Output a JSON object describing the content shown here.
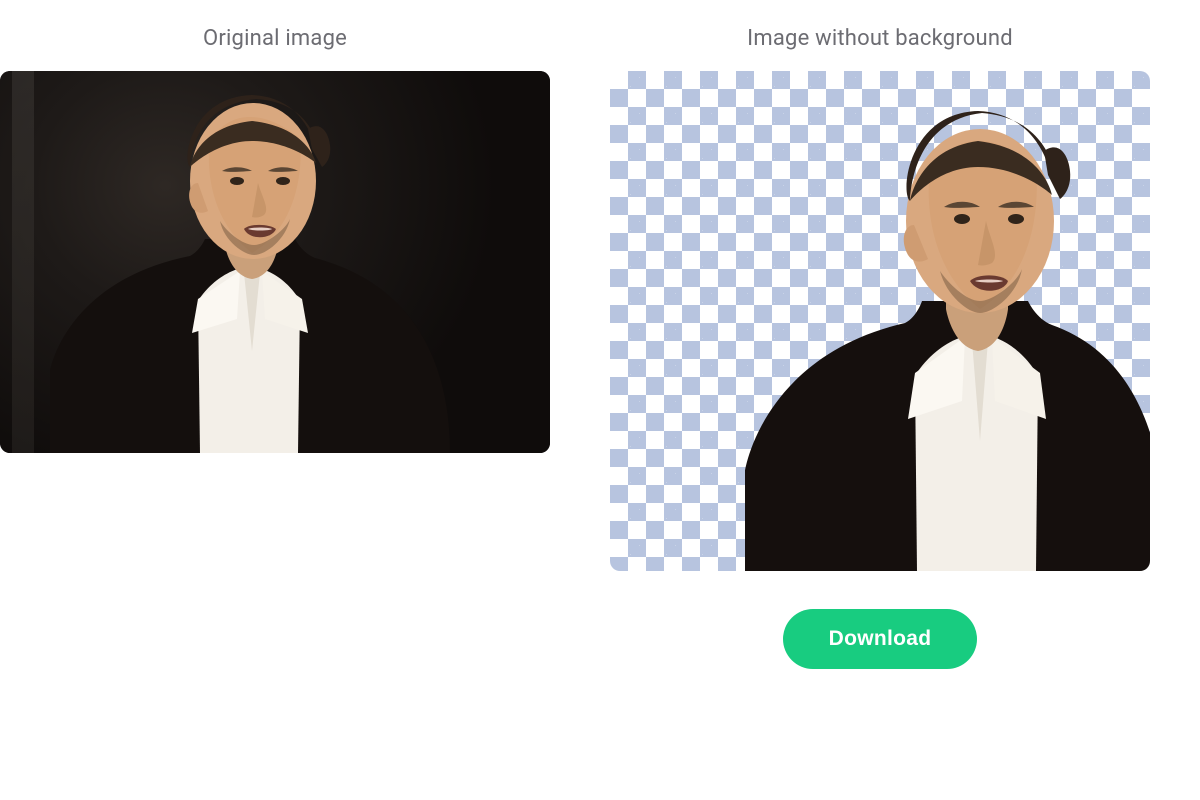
{
  "panels": {
    "original": {
      "title": "Original image"
    },
    "result": {
      "title": "Image without background"
    }
  },
  "actions": {
    "download_label": "Download"
  },
  "colors": {
    "accent": "#18cc80",
    "title": "#6c6c72",
    "checker_dark": "#b7c4df",
    "checker_light": "#ffffff"
  }
}
